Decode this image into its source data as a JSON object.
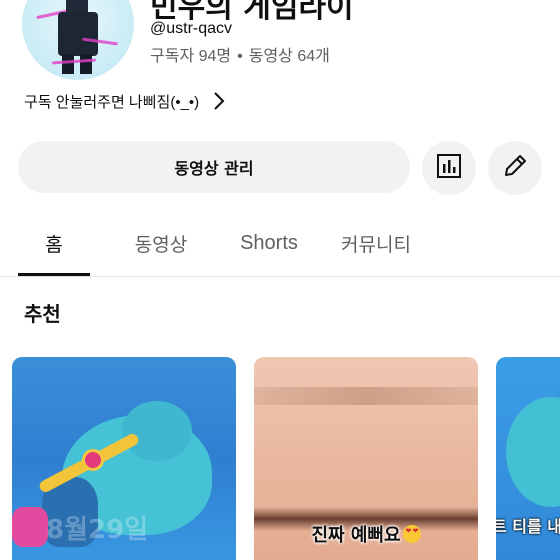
{
  "channel": {
    "name": "민우의 게임라이",
    "handle": "@ustr-qacv",
    "subscribers": "구독자 94명",
    "separator": "•",
    "videos": "동영상 64개",
    "description": "구독 안눌러주면 나삐짐(•_•)"
  },
  "actions": {
    "manage_videos": "동영상 관리",
    "analytics_icon": "analytics-icon",
    "edit_icon": "edit-pencil-icon"
  },
  "tabs": [
    {
      "label": "홈",
      "active": true
    },
    {
      "label": "동영상",
      "active": false
    },
    {
      "label": "Shorts",
      "active": false
    },
    {
      "label": "커뮤니티",
      "active": false
    }
  ],
  "section": {
    "title": "추천"
  },
  "cards": [
    {
      "watermark": "8월29일",
      "caption": ""
    },
    {
      "caption": "진짜 예뻐요"
    },
    {
      "caption": "트 티를 내"
    }
  ],
  "colors": {
    "button_bg": "#f2f2f2",
    "text_primary": "#0f0f0f",
    "text_secondary": "#606060"
  }
}
